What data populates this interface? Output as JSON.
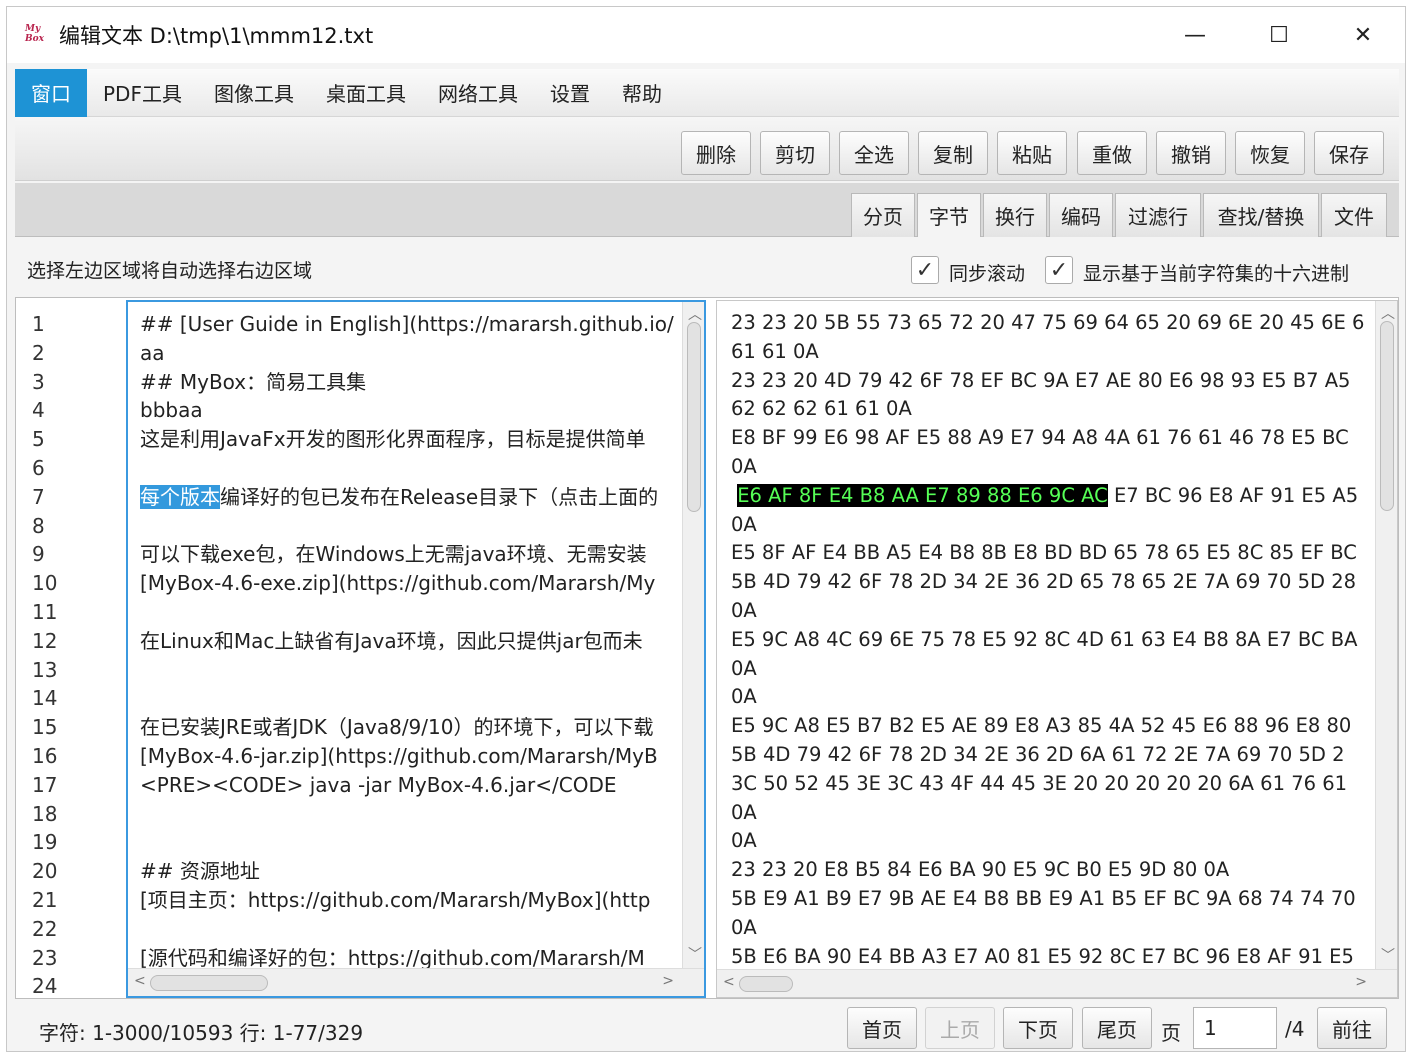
{
  "title": {
    "app_icon": "MyBox",
    "text": "编辑文本  D:\\tmp\\1\\mmm12.txt",
    "minimize": "—",
    "maximize": "☐",
    "close": "✕"
  },
  "menu": [
    "窗口",
    "PDF工具",
    "图像工具",
    "桌面工具",
    "网络工具",
    "设置",
    "帮助"
  ],
  "toolbar": {
    "delete": "删除",
    "cut": "剪切",
    "select_all": "全选",
    "copy": "复制",
    "paste": "粘贴",
    "redo": "重做",
    "undo": "撤销",
    "recover": "恢复",
    "save": "保存"
  },
  "tabs": [
    "分页",
    "字节",
    "换行",
    "编码",
    "过滤行",
    "查找/替换",
    "文件"
  ],
  "active_tab": "字节",
  "info": {
    "hint": "选择左边区域将自动选择右边区域",
    "sync_scroll": "同步滚动",
    "show_hex": "显示基于当前字符集的十六进制",
    "check_mark": "✓"
  },
  "line_numbers": [
    "1",
    "2",
    "3",
    "4",
    "5",
    "6",
    "7",
    "8",
    "9",
    "10",
    "11",
    "12",
    "13",
    "14",
    "15",
    "16",
    "17",
    "18",
    "19",
    "20",
    "21",
    "22",
    "23",
    "24"
  ],
  "text_lines": [
    "## [User Guide in English](https://mararsh.github.io/",
    "aa",
    "## MyBox：简易工具集",
    "bbbaa",
    "这是利用JavaFx开发的图形化界面程序，目标是提供简单",
    "",
    "",
    "",
    "可以下载exe包，在Windows上无需java环境、无需安装",
    "[MyBox-4.6-exe.zip](https://github.com/Mararsh/My",
    "",
    "在Linux和Mac上缺省有Java环境，因此只提供jar包而未",
    "",
    "",
    "在已安装JRE或者JDK（Java8/9/10）的环境下，可以下载",
    "[MyBox-4.6-jar.zip](https://github.com/Mararsh/MyB",
    "<PRE><CODE>     java  -jar   MyBox-4.6.jar</CODE",
    "",
    "",
    "## 资源地址",
    "[项目主页：https://github.com/Mararsh/MyBox](http",
    "",
    "[源代码和编译好的包：https://github.com/Mararsh/M",
    ""
  ],
  "text_line7": {
    "selected": "每个版本",
    "rest": "编译好的包已发布在Release目录下（点击上面的"
  },
  "hex_lines": [
    "23 23 20 5B 55 73 65 72 20 47 75 69 64 65 20 69 6E 20 45 6E 6",
    " 61 61 0A",
    " 23 23 20 4D 79 42 6F 78 EF BC 9A E7 AE 80 E6 98 93 E5 B7 A5",
    " 62 62 62 61 61 0A",
    " E8 BF 99 E6 98 AF E5 88 A9 E7 94 A8 4A 61 76 61 46 78 E5 BC",
    " 0A",
    "",
    " 0A",
    " E5 8F AF E4 BB A5 E4 B8 8B E8 BD BD 65 78 65 E5 8C 85 EF BC",
    " 5B 4D 79 42 6F 78 2D 34 2E 36 2D 65 78 65 2E 7A 69 70 5D 28",
    " 0A",
    " E5 9C A8 4C 69 6E 75 78 E5 92 8C 4D 61 63 E4 B8 8A E7 BC BA",
    " 0A",
    " 0A",
    " E5 9C A8 E5 B7 B2 E5 AE 89 E8 A3 85 4A 52 45 E6 88 96 E8 80",
    " 5B 4D 79 42 6F 78 2D 34 2E 36 2D 6A 61 72 2E 7A 69 70 5D 2",
    " 3C 50 52 45 3E 3C 43 4F 44 45 3E 20 20 20 20 20 6A 61 76 61",
    " 0A",
    " 0A",
    " 23 23 20 E8 B5 84 E6 BA 90 E5 9C B0 E5 9D 80 0A",
    " 5B E9 A1 B9 E7 9B AE E4 B8 BB E9 A1 B5 EF BC 9A 68 74 74 70",
    " 0A",
    " 5B E6 BA 90 E4 BB A3 E7 A0 81 E5 92 8C E7 BC 96 E8 AF 91 E5",
    ""
  ],
  "hex_line7": {
    "selected": "E6 AF 8F E4 B8 AA E7 89 88 E6 9C AC",
    "rest": " E7 BC 96 E8 AF 91 E5 A5"
  },
  "status": {
    "text": "字符: 1-3000/10593 行: 1-77/329",
    "first": "首页",
    "prev": "上页",
    "next": "下页",
    "last": "尾页",
    "page_label": "页",
    "page_value": "1",
    "page_total": "/4",
    "go": "前往"
  },
  "colors": {
    "accent": "#1e93d5",
    "selection_blue": "#3399dd",
    "hex_selection_fg": "#56ff56",
    "hex_selection_bg": "#000000"
  }
}
